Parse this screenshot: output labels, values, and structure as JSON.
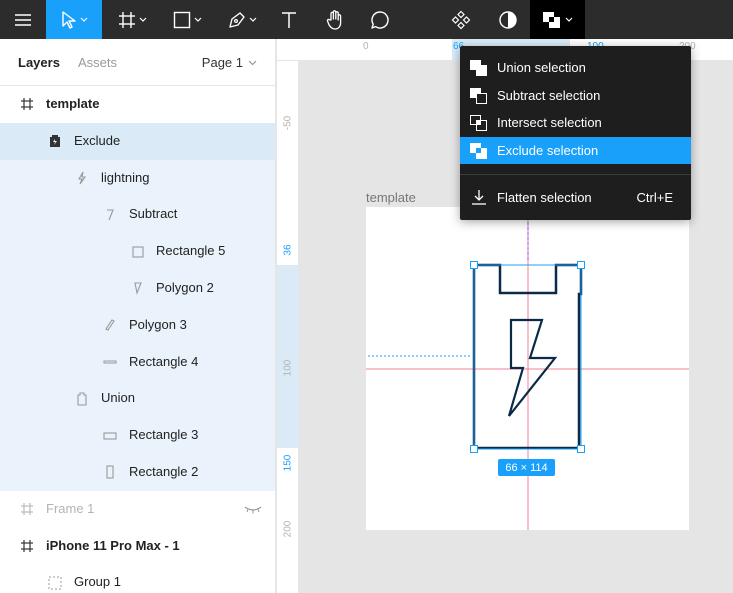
{
  "toolbar": {
    "items": [
      "menu-icon",
      "move-tool-icon",
      "frame-tool-icon",
      "shape-tool-icon",
      "pen-tool-icon",
      "text-tool-icon",
      "hand-tool-icon",
      "comment-tool-icon",
      "component-icon",
      "mask-icon",
      "boolean-operations-icon"
    ],
    "accent": "#18a0fb",
    "background": "#2c2c2c"
  },
  "left_panel": {
    "tab_layers": "Layers",
    "tab_assets": "Assets",
    "page_selector": "Page 1",
    "layers": [
      {
        "name": "template",
        "icon": "frame-icon",
        "style": "bold"
      },
      {
        "name": "Exclude",
        "icon": "exclude-icon",
        "style": "selected"
      },
      {
        "name": "lightning",
        "icon": "vector-icon",
        "style": "child"
      },
      {
        "name": "Subtract",
        "icon": "subtract-icon",
        "style": "child"
      },
      {
        "name": "Rectangle 5",
        "icon": "rectangle-icon",
        "style": "child"
      },
      {
        "name": "Polygon 2",
        "icon": "polygon-icon",
        "style": "child"
      },
      {
        "name": "Polygon 3",
        "icon": "polygon-icon",
        "style": "child"
      },
      {
        "name": "Rectangle 4",
        "icon": "line-icon",
        "style": "child"
      },
      {
        "name": "Union",
        "icon": "union-icon",
        "style": "child"
      },
      {
        "name": "Rectangle 3",
        "icon": "rectangle-icon",
        "style": "child"
      },
      {
        "name": "Rectangle 2",
        "icon": "rectangle-icon",
        "style": "child"
      },
      {
        "name": "Frame 1",
        "icon": "frame-icon",
        "style": "hidden"
      },
      {
        "name": "iPhone 11 Pro Max - 1",
        "icon": "frame-icon",
        "style": "bold"
      },
      {
        "name": "Group 1",
        "icon": "group-icon",
        "style": "normal"
      }
    ]
  },
  "rulers": {
    "top": [
      "0",
      "66",
      "100",
      "200"
    ],
    "left": [
      "-50",
      "36",
      "100",
      "150",
      "200"
    ]
  },
  "canvas": {
    "frame_label": "template",
    "dimensions": "66 × 114"
  },
  "menu": {
    "items": [
      {
        "label": "Union selection",
        "icon": "union-selection-icon"
      },
      {
        "label": "Subtract selection",
        "icon": "subtract-selection-icon"
      },
      {
        "label": "Intersect selection",
        "icon": "intersect-selection-icon"
      },
      {
        "label": "Exclude selection",
        "icon": "exclude-selection-icon",
        "active": true
      }
    ],
    "flatten": {
      "label": "Flatten selection",
      "shortcut": "Ctrl+E",
      "icon": "flatten-icon"
    }
  }
}
